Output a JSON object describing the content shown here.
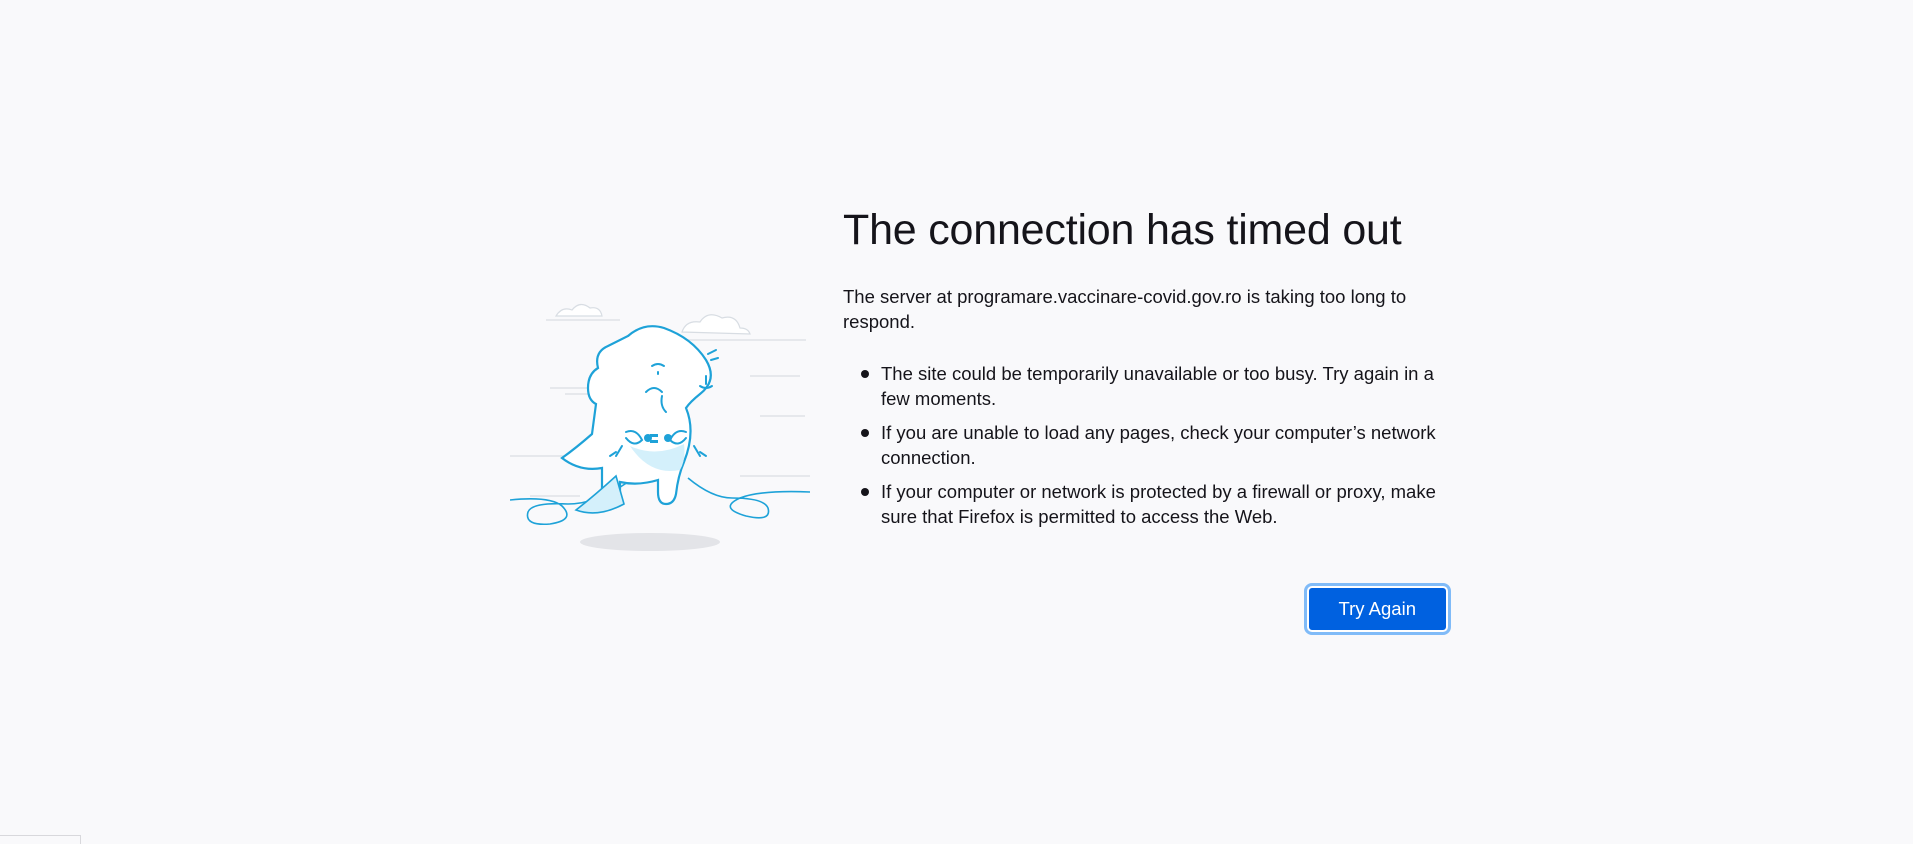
{
  "error_page": {
    "title": "The connection has timed out",
    "description": "The server at programare.vaccinare-covid.gov.ro is taking too long to respond.",
    "reasons": [
      "The site could be temporarily unavailable or too busy. Try again in a few moments.",
      "If you are unable to load any pages, check your computer’s network connection.",
      "If your computer or network is protected by a firewall or proxy, make sure that Firefox is permitted to access the Web."
    ],
    "try_again_label": "Try Again",
    "illustration_icon": "unplugged-dinosaur-icon"
  },
  "colors": {
    "background": "#f9f9fb",
    "text": "#15141a",
    "accent": "#0061e0",
    "focus_ring": "#80bbf8",
    "illustration_stroke": "#1ea2d8",
    "illustration_fill": "#d4f0fb"
  }
}
